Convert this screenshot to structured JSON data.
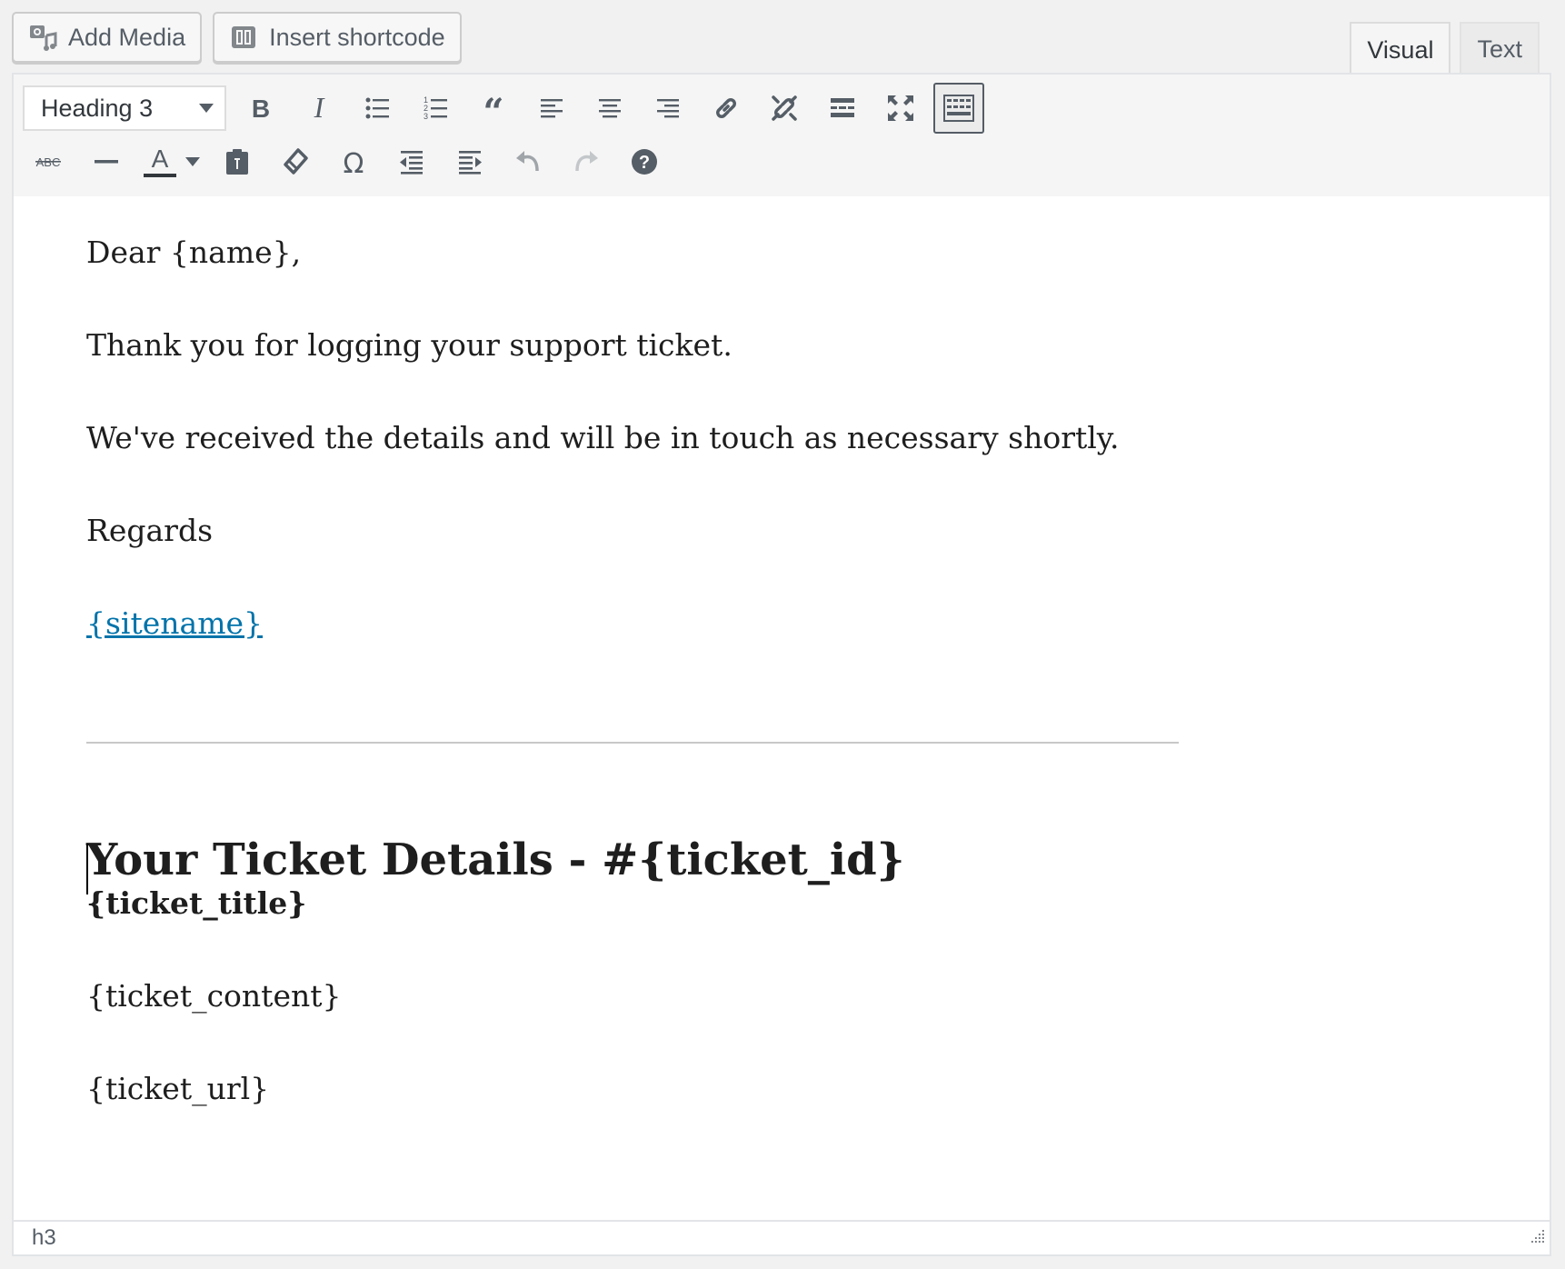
{
  "media_buttons": {
    "add_media": "Add Media",
    "insert_shortcode": "Insert shortcode"
  },
  "tabs": {
    "visual": "Visual",
    "text": "Text",
    "active": "visual"
  },
  "toolbar": {
    "format_select_value": "Heading 3",
    "row1_icons": [
      "bold-icon",
      "italic-icon",
      "bulleted-list-icon",
      "numbered-list-icon",
      "blockquote-icon",
      "align-left-icon",
      "align-center-icon",
      "align-right-icon",
      "link-icon",
      "unlink-icon",
      "read-more-icon",
      "fullscreen-icon",
      "toolbar-toggle-icon"
    ],
    "row2_icons": [
      "strikethrough-icon",
      "horizontal-line-icon",
      "text-color-icon",
      "paste-as-text-icon",
      "clear-formatting-icon",
      "special-character-icon",
      "outdent-icon",
      "indent-icon",
      "undo-icon",
      "redo-icon",
      "help-icon"
    ],
    "text_color_underline": "#32373c"
  },
  "content": {
    "greeting": "Dear {name},",
    "line1": "Thank you for logging your support ticket.",
    "line2": "We've received the details and will be in touch as necessary shortly.",
    "sign_off": "Regards",
    "site_link": "{sitename}",
    "heading": "Your Ticket Details - #{ticket_id}",
    "ticket_title": "{ticket_title}",
    "ticket_content": "{ticket_content}",
    "ticket_url": "{ticket_url}"
  },
  "status_bar": {
    "path": "h3"
  },
  "colors": {
    "link": "#0073aa",
    "toolbar_bg": "#f5f5f5",
    "icon": "#555d66"
  }
}
